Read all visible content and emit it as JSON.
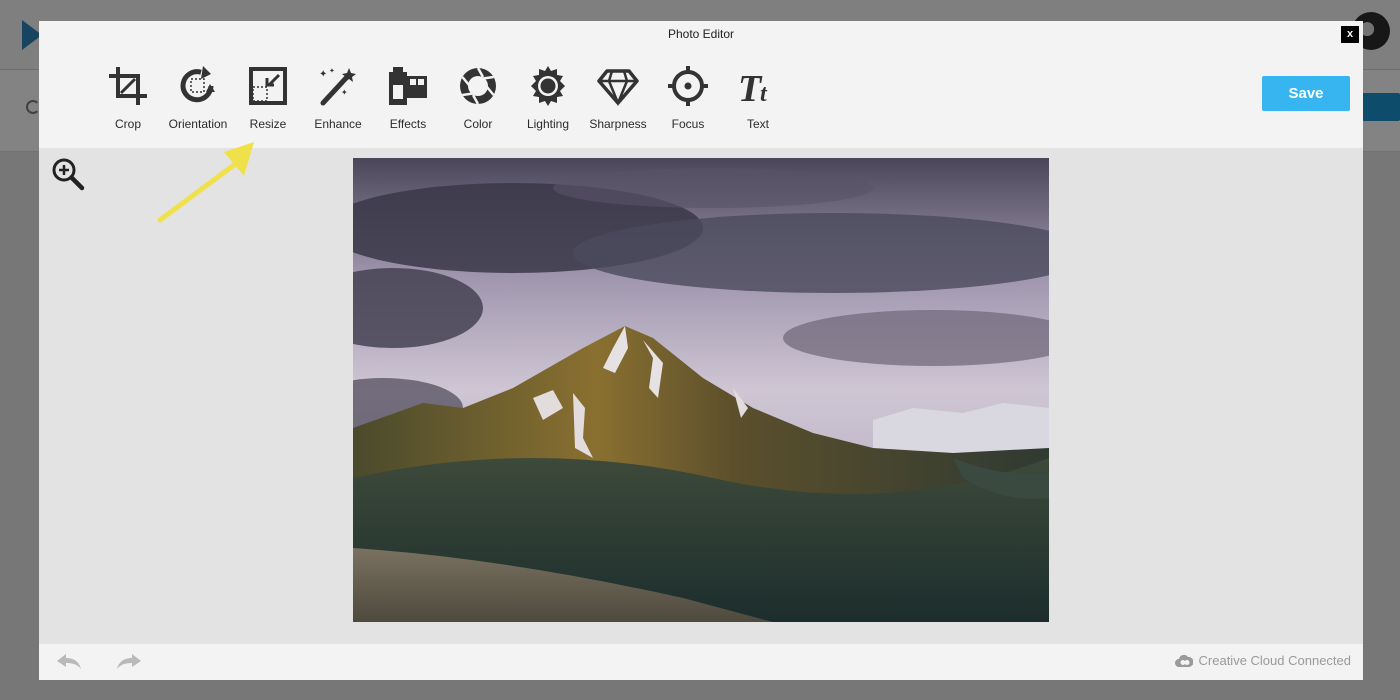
{
  "modal": {
    "title": "Photo Editor",
    "close_label": "x",
    "save_label": "Save"
  },
  "tools": [
    {
      "label": "Crop",
      "icon": "crop-icon"
    },
    {
      "label": "Orientation",
      "icon": "orientation-icon"
    },
    {
      "label": "Resize",
      "icon": "resize-icon"
    },
    {
      "label": "Enhance",
      "icon": "magic-wand-icon"
    },
    {
      "label": "Effects",
      "icon": "film-icon"
    },
    {
      "label": "Color",
      "icon": "aperture-icon"
    },
    {
      "label": "Lighting",
      "icon": "sun-icon"
    },
    {
      "label": "Sharpness",
      "icon": "diamond-icon"
    },
    {
      "label": "Focus",
      "icon": "crosshair-icon"
    },
    {
      "label": "Text",
      "icon": "text-icon"
    }
  ],
  "footer": {
    "cloud_status": "Creative Cloud Connected"
  },
  "colors": {
    "save_button": "#36b5f0",
    "annotation_arrow": "#f0e04a",
    "icon": "#333333"
  }
}
